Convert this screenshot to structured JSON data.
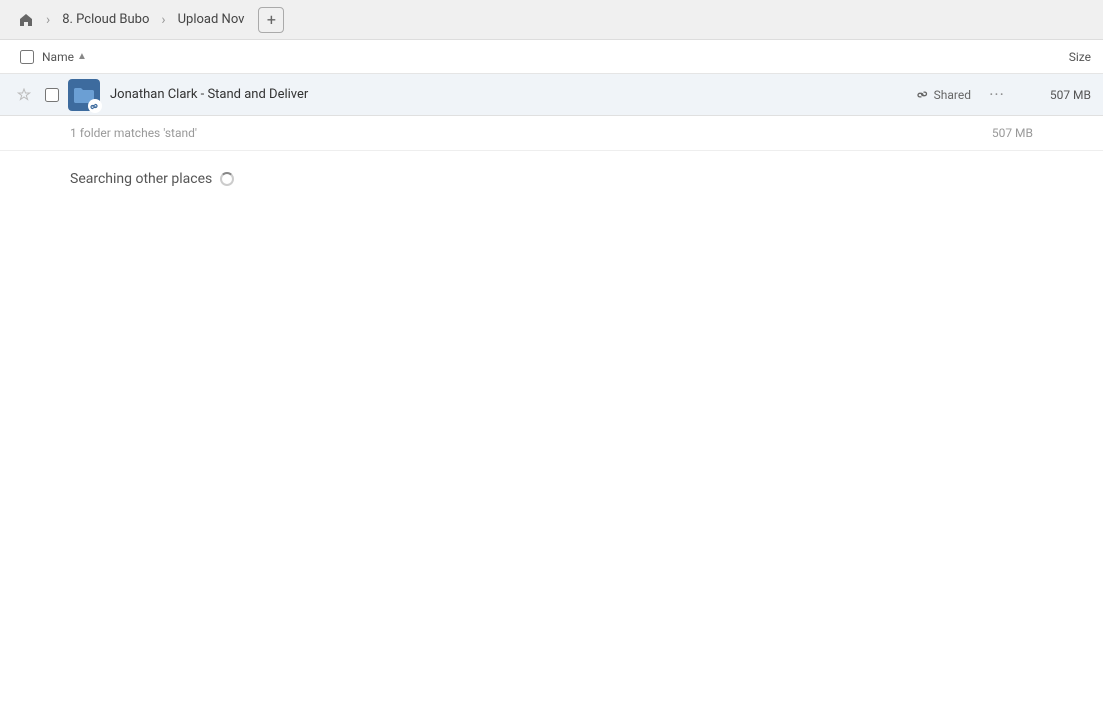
{
  "topBar": {
    "homeLabel": "Home",
    "breadcrumbs": [
      {
        "label": "8. Pcloud Bubo"
      },
      {
        "label": "Upload Nov"
      }
    ],
    "addButtonLabel": "+"
  },
  "columns": {
    "nameLabel": "Name",
    "sortIndicator": "▲",
    "sizeLabel": "Size"
  },
  "fileRow": {
    "name": "Jonathan Clark - Stand and Deliver",
    "sharedLabel": "Shared",
    "size": "507 MB",
    "actions": "···"
  },
  "resultsSummary": {
    "text": "1 folder matches 'stand'",
    "size": "507 MB"
  },
  "searchingSection": {
    "text": "Searching other places"
  },
  "icons": {
    "home": "🏠",
    "star": "☆",
    "linkChain": "🔗"
  }
}
